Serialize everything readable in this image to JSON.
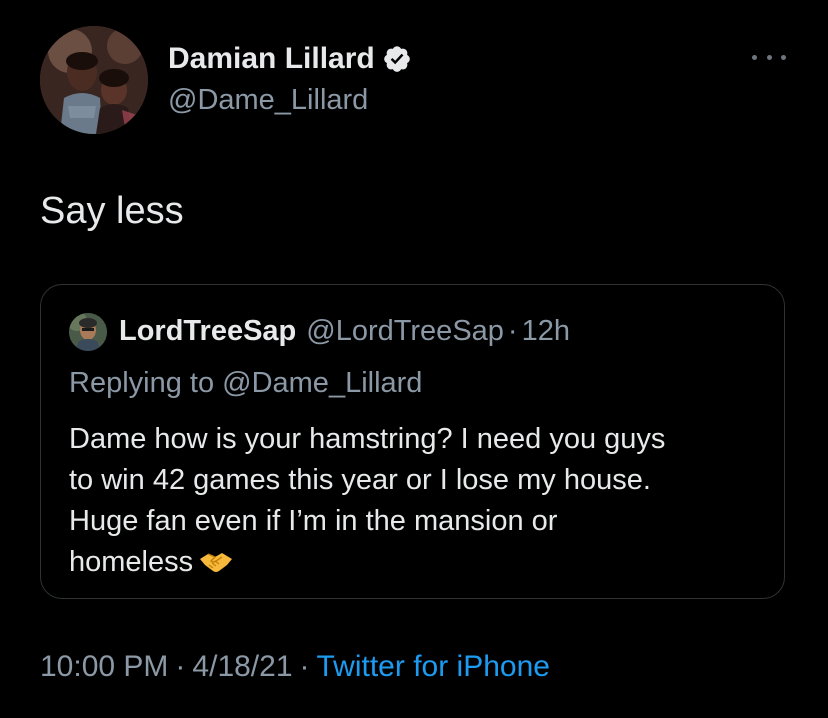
{
  "tweet": {
    "author": {
      "name": "Damian Lillard",
      "handle": "@Dame_Lillard",
      "verified": true,
      "avatar_icon": "profile-photo"
    },
    "more_icon": "ellipsis-icon",
    "text": "Say less",
    "quoted": {
      "author_name": "LordTreeSap",
      "author_handle": "@LordTreeSap",
      "separator": "·",
      "time": "12h",
      "replying_to": "Replying to @Dame_Lillard",
      "body_lines": [
        "Dame how is your hamstring? I need you guys",
        "to win 42 games this year or I lose my house.",
        "Huge fan even if I’m in the mansion or",
        "homeless"
      ],
      "emoji": "handshake-emoji"
    },
    "meta": {
      "time": "10:00 PM",
      "separator": "·",
      "date": "4/18/21",
      "source": "Twitter for iPhone"
    }
  },
  "colors": {
    "background": "#000000",
    "primary_text": "#e7e9ea",
    "secondary_text": "#8b98a5",
    "link": "#1d9bf0",
    "border": "#2f3336",
    "verified_badge": "#e7e9ea"
  }
}
